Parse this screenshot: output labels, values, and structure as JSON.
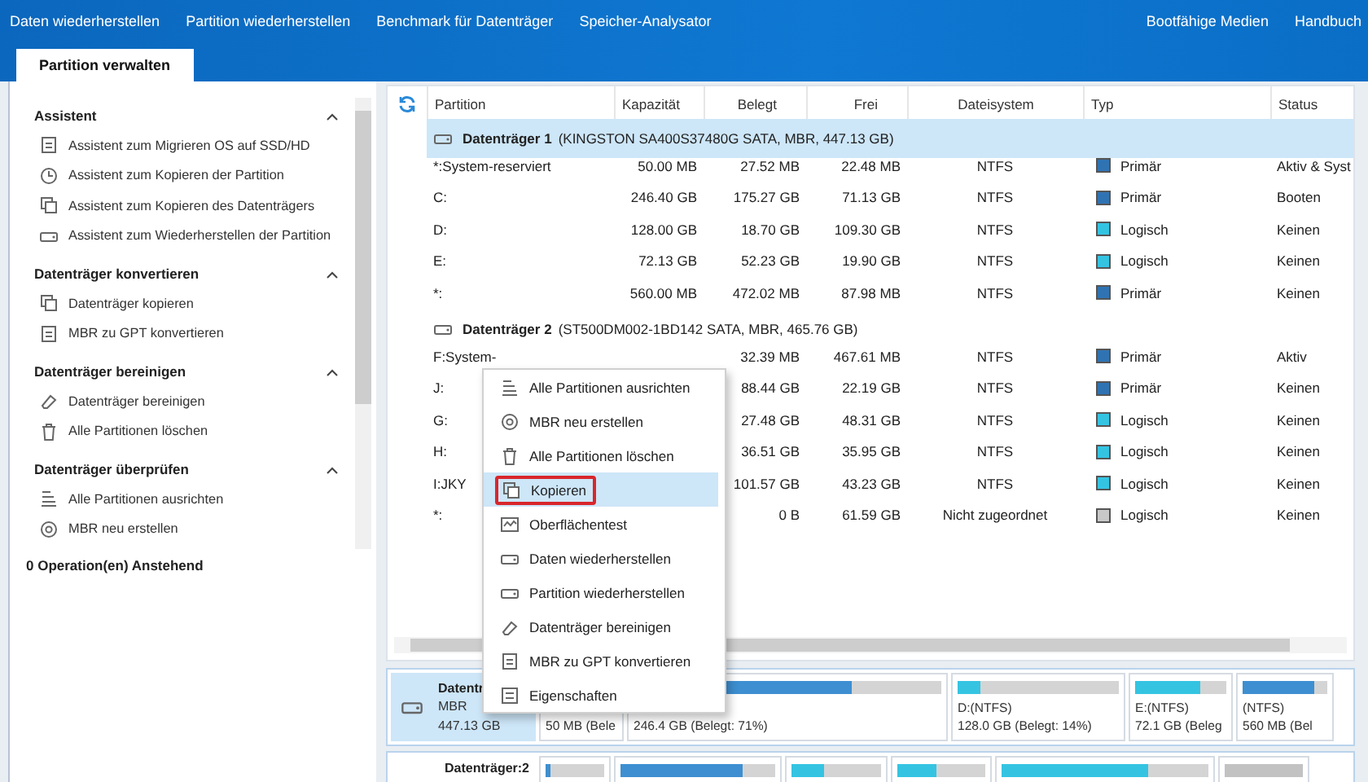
{
  "nav": {
    "left": [
      "Daten wiederherstellen",
      "Partition wiederherstellen",
      "Benchmark für Datenträger",
      "Speicher-Analysator"
    ],
    "right": [
      "Bootfähige Medien",
      "Handbuch"
    ]
  },
  "tabs": [
    {
      "label": "Partition verwalten",
      "selected": true
    }
  ],
  "sidebar": {
    "sections": [
      {
        "title": "Assistent",
        "expanded": true,
        "items": [
          "Assistent zum Migrieren OS auf SSD/HD",
          "Assistent zum Kopieren der Partition",
          "Assistent zum Kopieren des Datenträgers",
          "Assistent zum Wiederherstellen der Partition"
        ]
      },
      {
        "title": "Datenträger konvertieren",
        "expanded": true,
        "items": [
          "Datenträger kopieren",
          "MBR zu GPT konvertieren"
        ]
      },
      {
        "title": "Datenträger bereinigen",
        "expanded": true,
        "items": [
          "Datenträger bereinigen",
          "Alle Partitionen löschen"
        ]
      },
      {
        "title": "Datenträger überprüfen",
        "expanded": true,
        "items": [
          "Alle Partitionen ausrichten",
          "MBR neu erstellen"
        ]
      }
    ],
    "pending": "0 Operation(en) Anstehend"
  },
  "table": {
    "columns": [
      "Partition",
      "Kapazität",
      "Belegt",
      "Frei",
      "Dateisystem",
      "Typ",
      "Status"
    ],
    "disks": [
      {
        "name": "Datenträger 1",
        "detail": "(KINGSTON SA400S37480G SATA, MBR, 447.13 GB)",
        "selected": true,
        "rows": [
          {
            "partition": "*:System-reserviert",
            "capacity": "50.00 MB",
            "used": "27.52 MB",
            "free": "22.48 MB",
            "fs": "NTFS",
            "type": "Primär",
            "color": "#2f73b3",
            "status": "Aktiv & Syst"
          },
          {
            "partition": "C:",
            "capacity": "246.40 GB",
            "used": "175.27 GB",
            "free": "71.13 GB",
            "fs": "NTFS",
            "type": "Primär",
            "color": "#2f73b3",
            "status": "Booten"
          },
          {
            "partition": "D:",
            "capacity": "128.00 GB",
            "used": "18.70 GB",
            "free": "109.30 GB",
            "fs": "NTFS",
            "type": "Logisch",
            "color": "#34c4e2",
            "status": "Keinen"
          },
          {
            "partition": "E:",
            "capacity": "72.13 GB",
            "used": "52.23 GB",
            "free": "19.90 GB",
            "fs": "NTFS",
            "type": "Logisch",
            "color": "#34c4e2",
            "status": "Keinen"
          },
          {
            "partition": "*:",
            "capacity": "560.00 MB",
            "used": "472.02 MB",
            "free": "87.98 MB",
            "fs": "NTFS",
            "type": "Primär",
            "color": "#2f73b3",
            "status": "Keinen"
          }
        ]
      },
      {
        "name": "Datenträger 2",
        "detail": "(ST500DM002-1BD142 SATA, MBR, 465.76 GB)",
        "selected": false,
        "rows": [
          {
            "partition": "F:System-",
            "used": "32.39 MB",
            "free": "467.61 MB",
            "fs": "NTFS",
            "type": "Primär",
            "color": "#2f73b3",
            "status": "Aktiv"
          },
          {
            "partition": "J:",
            "used": "88.44 GB",
            "free": "22.19 GB",
            "fs": "NTFS",
            "type": "Primär",
            "color": "#2f73b3",
            "status": "Keinen"
          },
          {
            "partition": "G:",
            "used": "27.48 GB",
            "free": "48.31 GB",
            "fs": "NTFS",
            "type": "Logisch",
            "color": "#34c4e2",
            "status": "Keinen"
          },
          {
            "partition": "H:",
            "used": "36.51 GB",
            "free": "35.95 GB",
            "fs": "NTFS",
            "type": "Logisch",
            "color": "#34c4e2",
            "status": "Keinen"
          },
          {
            "partition": "I:JKY",
            "used": "101.57 GB",
            "free": "43.23 GB",
            "fs": "NTFS",
            "type": "Logisch",
            "color": "#34c4e2",
            "status": "Keinen"
          },
          {
            "partition": "*:",
            "used": "0 B",
            "free": "61.59 GB",
            "fs": "Nicht zugeordnet",
            "type": "Logisch",
            "color": "#c8c8c8",
            "status": "Keinen"
          }
        ]
      }
    ]
  },
  "context_menu": {
    "items": [
      {
        "label": "Alle Partitionen ausrichten",
        "selected": false
      },
      {
        "label": "MBR neu erstellen",
        "selected": false
      },
      {
        "label": "Alle Partitionen löschen",
        "selected": false
      },
      {
        "label": "Kopieren",
        "selected": true
      },
      {
        "label": "Oberflächentest",
        "selected": false
      },
      {
        "label": "Daten wiederherstellen",
        "selected": false
      },
      {
        "label": "Partition wiederherstellen",
        "selected": false
      },
      {
        "label": "Datenträger bereinigen",
        "selected": false
      },
      {
        "label": "MBR zu GPT konvertieren",
        "selected": false
      },
      {
        "label": "Eigenschaften",
        "selected": false
      }
    ]
  },
  "disk_map": {
    "disks": [
      {
        "name": "Datentr",
        "type": "MBR",
        "size": "447.13 GB",
        "selected": true,
        "partitions": [
          {
            "info": "50 MB (Bele"
          },
          {
            "info": "246.4 GB (Belegt: 71%)",
            "level": 0.71,
            "color": "#3d8fd1"
          },
          {
            "label": "D:(NTFS)",
            "info": "128.0 GB (Belegt: 14%)",
            "level": 0.14,
            "color": "#34c4e2"
          },
          {
            "label": "E:(NTFS)",
            "info": "72.1 GB (Beleg",
            "level": 0.72,
            "color": "#34c4e2"
          },
          {
            "label": "(NTFS)",
            "info": "560 MB (Bel",
            "level": 0.84,
            "color": "#3d8fd1"
          }
        ]
      },
      {
        "name": "Datenträger:2",
        "selected": false,
        "partitions": [
          {
            "level": 0.07,
            "color": "#3d8fd1"
          },
          {
            "level": 0.79,
            "color": "#3d8fd1"
          },
          {
            "level": 0.37,
            "color": "#34c4e2"
          },
          {
            "level": 0.44,
            "color": "#34c4e2"
          },
          {
            "level": 0.71,
            "color": "#34c4e2"
          },
          {
            "kind": "unallocated"
          }
        ]
      }
    ]
  }
}
